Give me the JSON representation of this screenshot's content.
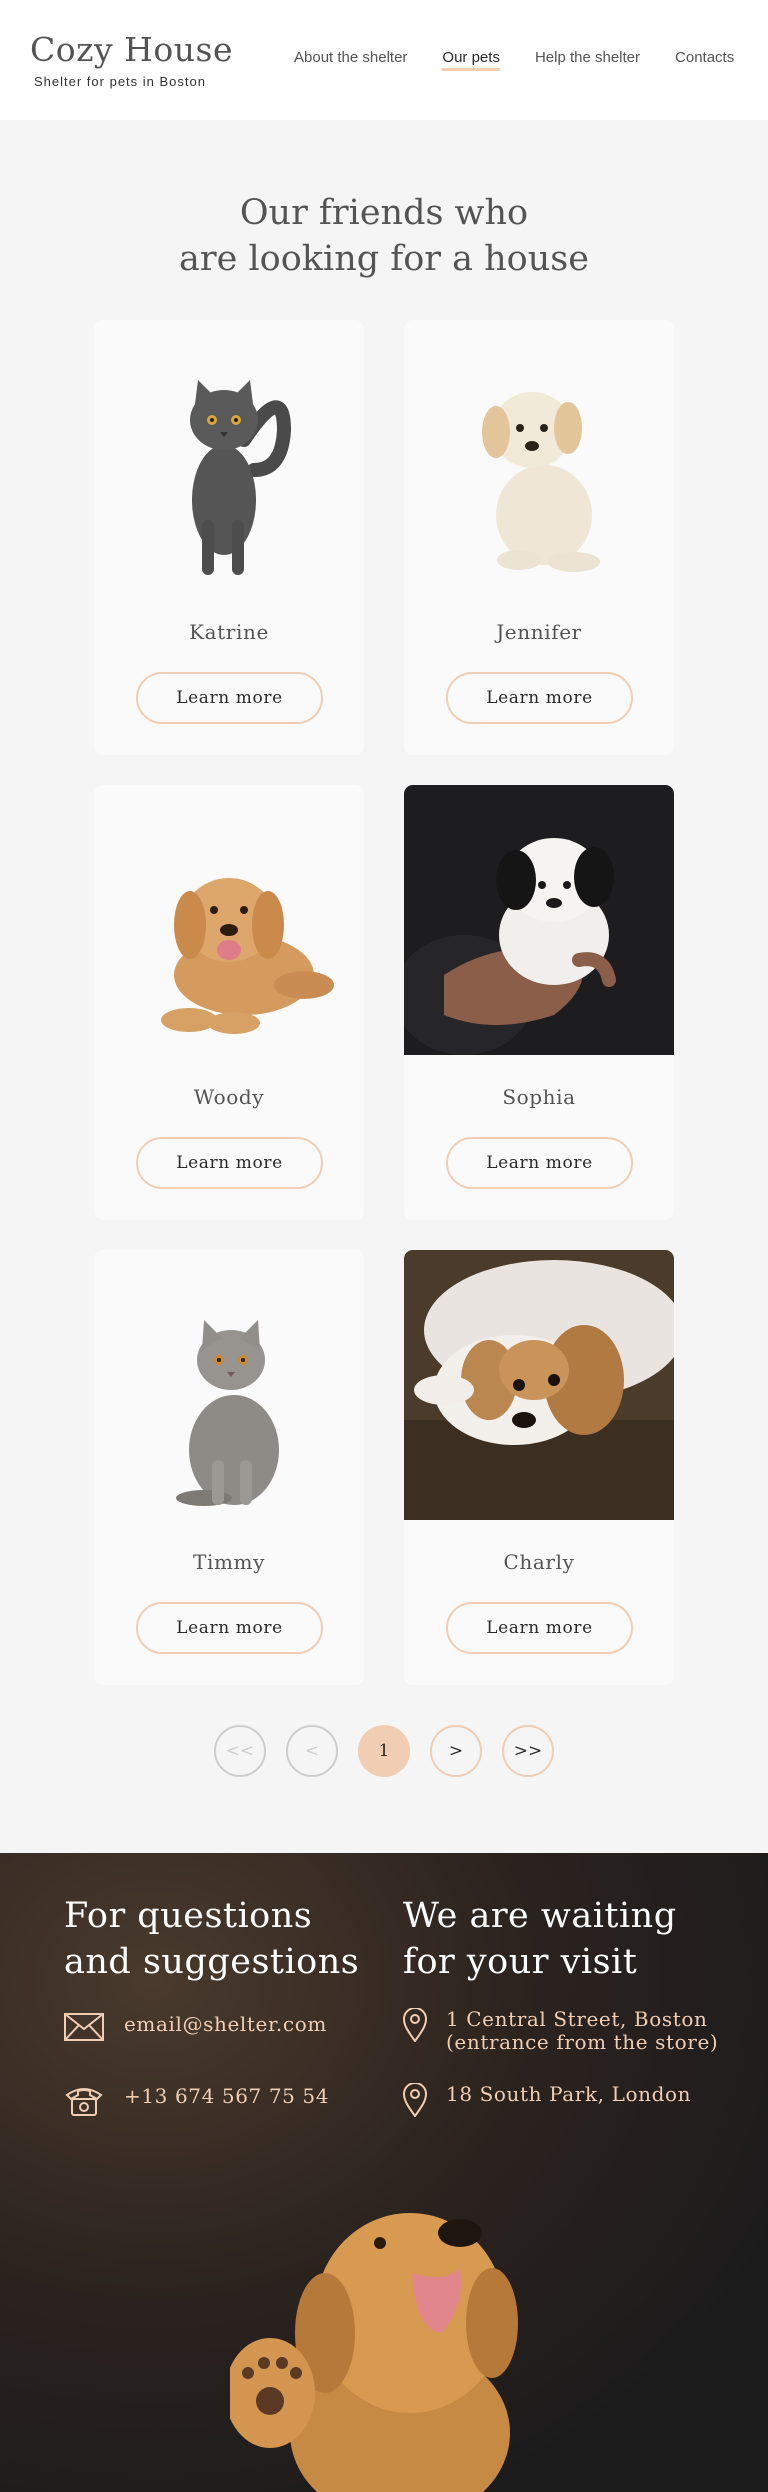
{
  "header": {
    "logo_title": "Cozy House",
    "logo_subtitle": "Shelter for pets in Boston",
    "nav": [
      {
        "label": "About the shelter",
        "active": false
      },
      {
        "label": "Our pets",
        "active": true
      },
      {
        "label": "Help the shelter",
        "active": false
      },
      {
        "label": "Contacts",
        "active": false
      }
    ]
  },
  "pets": {
    "title": "Our friends who\nare looking for a house",
    "button_label": "Learn more",
    "cards": [
      {
        "name": "Katrine",
        "image": "gray-cat-standing"
      },
      {
        "name": "Jennifer",
        "image": "cream-puppy-sitting"
      },
      {
        "name": "Woody",
        "image": "golden-retriever-lying"
      },
      {
        "name": "Sophia",
        "image": "black-white-puppy-in-hands"
      },
      {
        "name": "Timmy",
        "image": "british-shorthair-cat-sitting"
      },
      {
        "name": "Charly",
        "image": "beagle-mix-dog-resting"
      }
    ]
  },
  "pagination": {
    "first": "<<",
    "prev": "<",
    "current": "1",
    "next": ">",
    "last": ">>"
  },
  "footer": {
    "questions_title": "For questions\nand suggestions",
    "email": "email@shelter.com",
    "phone": "+13 674 567 75 54",
    "visit_title": "We are waiting\nfor your visit",
    "address_1": "1 Central Street, Boston\n(entrance from the store)",
    "address_2": "18 South Park, London",
    "image": "golden-puppy-waving"
  },
  "colors": {
    "accent": "#f1cdb3",
    "text_dark": "#292929",
    "text_gray": "#545454",
    "disabled": "#cdcdcd",
    "background": "#f5f5f5",
    "card_bg": "#fafafa"
  }
}
